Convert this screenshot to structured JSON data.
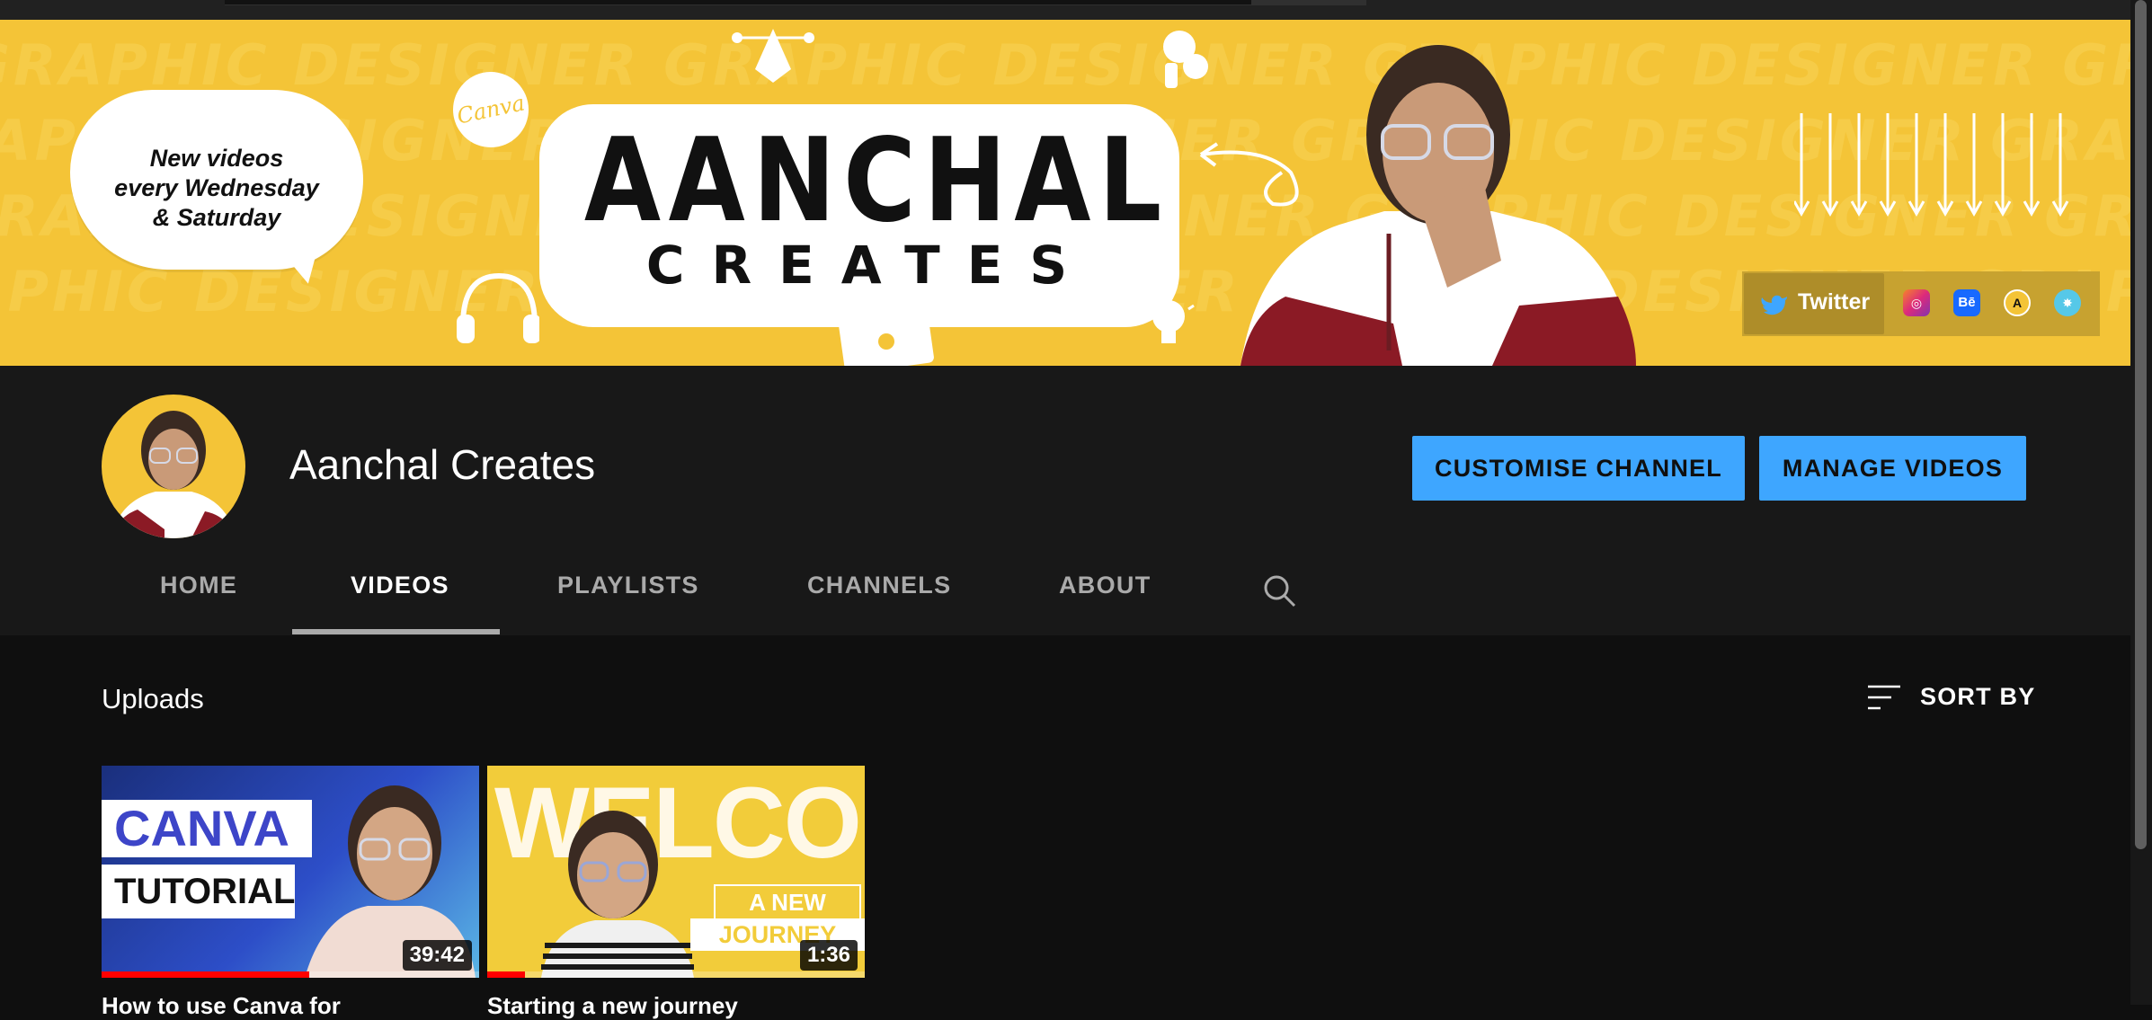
{
  "banner": {
    "watermark_text": "GRAPHIC DESIGNER GRAPHIC DESIGNER GRAPHIC DESIGNER GRAPHIC DESIGNER",
    "bubble_lines": [
      "New videos",
      "every Wednesday",
      "& Saturday"
    ],
    "canva_badge": "Canva",
    "logo_title": "AANCHAL",
    "logo_subtitle": "CREATES",
    "social_links": {
      "twitter_label": "Twitter",
      "icons": [
        "instagram-icon",
        "behance-icon",
        "link-icon",
        "website-icon"
      ]
    }
  },
  "channel": {
    "name": "Aanchal Creates",
    "customise_label": "CUSTOMISE CHANNEL",
    "manage_label": "MANAGE VIDEOS"
  },
  "tabs": {
    "home": "HOME",
    "videos": "VIDEOS",
    "playlists": "PLAYLISTS",
    "channels": "CHANNELS",
    "about": "ABOUT",
    "active": "VIDEOS"
  },
  "uploads": {
    "title": "Uploads",
    "sort_label": "SORT BY",
    "videos": [
      {
        "thumb_line1": "CANVA",
        "thumb_line2": "TUTORIAL",
        "duration": "39:42",
        "watched_fraction": 0.55,
        "title": "How to use Canva for"
      },
      {
        "thumb_line1": "WELCOME",
        "thumb_line2": "A NEW",
        "thumb_line3": "JOURNEY",
        "duration": "1:36",
        "watched_fraction": 0.1,
        "title": "Starting a new journey"
      }
    ]
  },
  "colors": {
    "banner_yellow": "#f4c437",
    "accent_blue": "#3ea6ff",
    "progress_red": "#ff0000",
    "page_bg": "#0f0f0f",
    "header_bg": "#181818"
  }
}
